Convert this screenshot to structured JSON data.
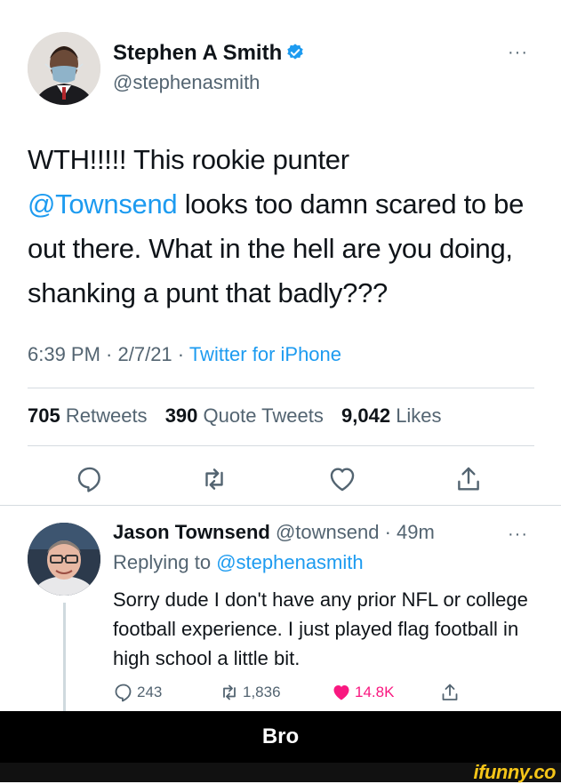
{
  "main_tweet": {
    "author_name": "Stephen A Smith",
    "author_handle": "@stephenasmith",
    "more_label": "···",
    "text_before_mention": "WTH!!!!! This rookie punter",
    "mention": "@Townsend",
    "text_after_mention": " looks too damn scared to be out there. What in the hell are you doing, shanking a punt that badly???",
    "time": "6:39 PM",
    "sep1": " · ",
    "date": "2/7/21",
    "sep2": " · ",
    "source": "Twitter for iPhone",
    "retweets_count": "705",
    "retweets_label": "Retweets",
    "quotes_count": "390",
    "quotes_label": "Quote Tweets",
    "likes_count": "9,042",
    "likes_label": "Likes",
    "icons": [
      "reply-icon",
      "retweet-icon",
      "like-icon",
      "share-icon"
    ]
  },
  "reply_tweet": {
    "author_name": "Jason Townsend",
    "author_handle": "@townsend",
    "sep": " · ",
    "time": "49m",
    "more_label": "···",
    "replying_to_label": "Replying to",
    "replying_to_handle": "@stephenasmith",
    "text": "Sorry dude I don't have any prior NFL or college football experience. I just played flag football in high school a little bit.",
    "reply_count": "243",
    "retweet_count": "1,836",
    "like_count": "14.8K",
    "like_color": "#f91880"
  },
  "caption": "Bro",
  "watermark": "ifunny.co",
  "colors": {
    "link": "#1d9bf0",
    "text": "#0f1419",
    "muted": "#536471",
    "caption_bg": "#000000",
    "watermark": "#f5c518"
  }
}
